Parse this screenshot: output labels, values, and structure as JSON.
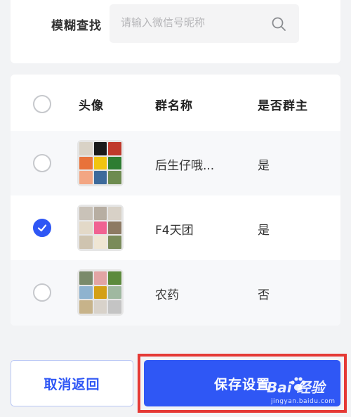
{
  "search": {
    "label": "模糊查找",
    "placeholder": "请输入微信号昵称"
  },
  "table": {
    "headers": {
      "avatar": "头像",
      "group_name": "群名称",
      "is_owner": "是否群主"
    },
    "rows": [
      {
        "selected": false,
        "group_name": "后生仔哦...",
        "is_owner": "是"
      },
      {
        "selected": true,
        "group_name": "F4天团",
        "is_owner": "是"
      },
      {
        "selected": false,
        "group_name": "农药",
        "is_owner": "否"
      }
    ]
  },
  "buttons": {
    "cancel_label": "取消返回",
    "save_label": "保存设置"
  },
  "watermark": {
    "brand": "Bai  经验",
    "url": "jingyan.baidu.com"
  },
  "colors": {
    "accent": "#2f57f5",
    "highlight_border": "#e53935",
    "row_alt": "#f7f8fa"
  }
}
